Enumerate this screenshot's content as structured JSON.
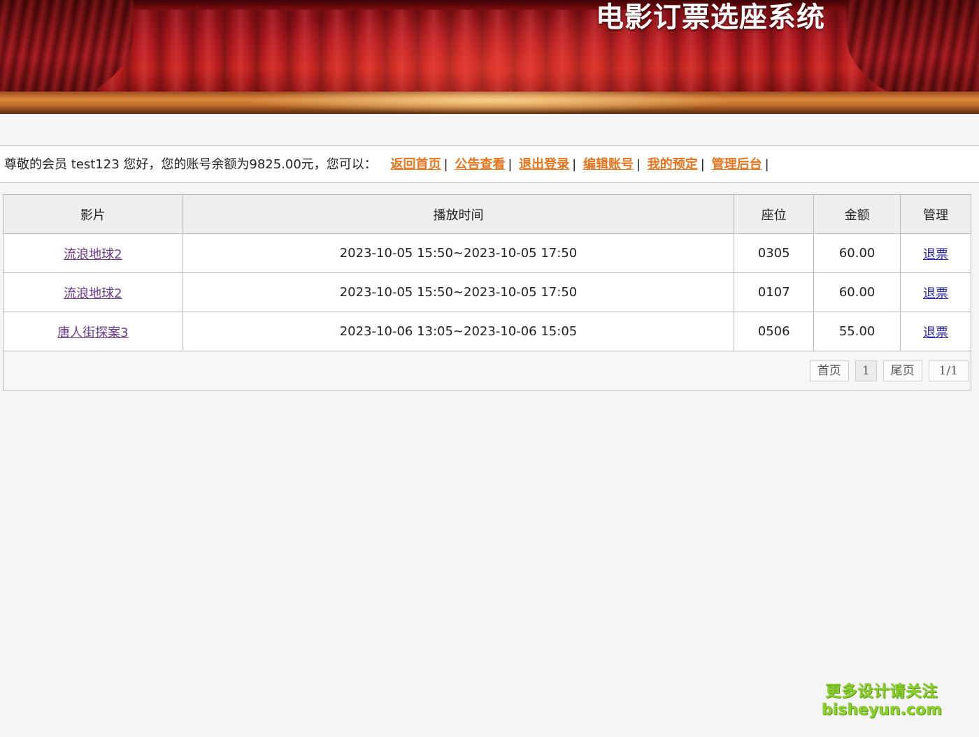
{
  "header": {
    "title": "电影订票选座系统"
  },
  "welcome": {
    "greeting": "尊敬的会员 test123 您好，您的账号余额为9825.00元，您可以：",
    "links": [
      "返回首页",
      "公告查看",
      "退出登录",
      "编辑账号",
      "我的预定",
      "管理后台"
    ],
    "separator": "|"
  },
  "orders": {
    "headers": [
      "影片",
      "播放时间",
      "座位",
      "金额",
      "管理"
    ],
    "rows": [
      {
        "movie": "流浪地球2",
        "time": "2023-10-05 15:50~2023-10-05 17:50",
        "seat": "0305",
        "amount": "60.00",
        "action": "退票"
      },
      {
        "movie": "流浪地球2",
        "time": "2023-10-05 15:50~2023-10-05 17:50",
        "seat": "0107",
        "amount": "60.00",
        "action": "退票"
      },
      {
        "movie": "唐人街探案3",
        "time": "2023-10-06 13:05~2023-10-06 15:05",
        "seat": "0506",
        "amount": "55.00",
        "action": "退票"
      }
    ]
  },
  "pager": {
    "first": "首页",
    "current_page": "1",
    "last": "尾页",
    "info": "1/1"
  },
  "watermark": {
    "line1": "更多设计请关注",
    "line2": "bisheyun.com"
  },
  "colors": {
    "link_orange": "#e8731a",
    "movie_link": "#6b3a8a",
    "refund_link": "#2a2aa8",
    "curtain_red": "#b3181f"
  }
}
